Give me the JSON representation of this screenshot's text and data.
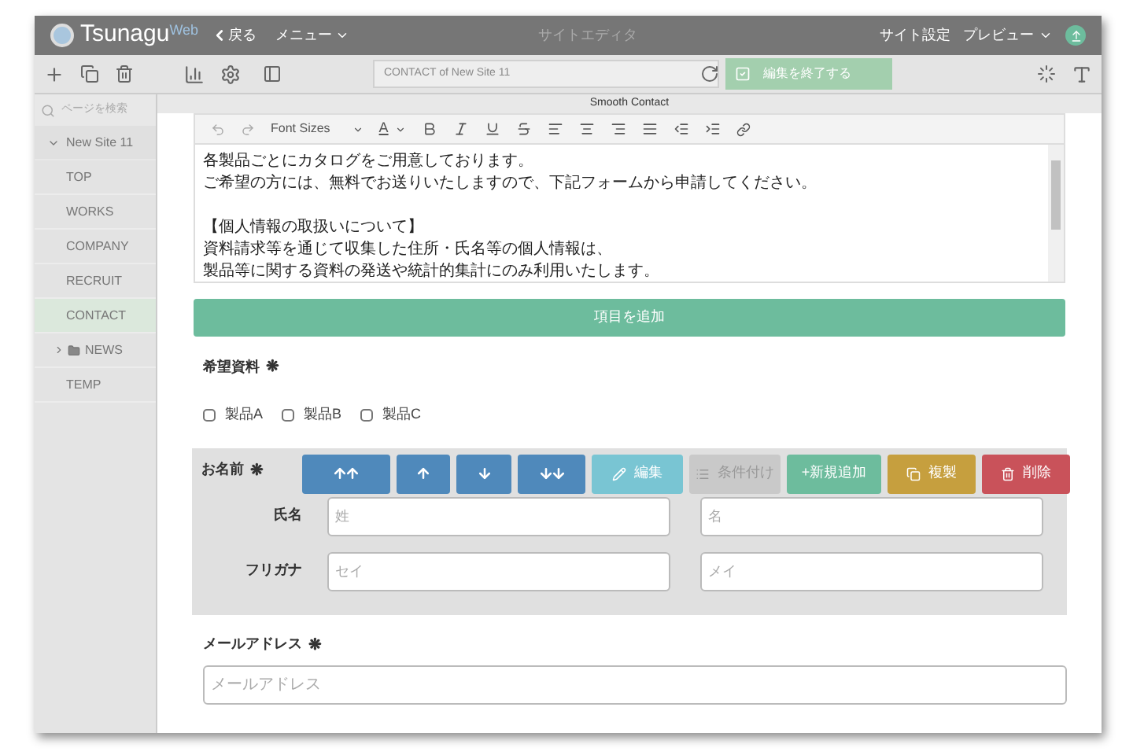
{
  "header": {
    "logo": "Tsunagu",
    "logo_suffix": "Web",
    "back": "戻る",
    "menu": "メニュー",
    "title": "サイトエディタ",
    "site_settings": "サイト設定",
    "preview": "プレビュー"
  },
  "toolbar": {
    "page_path": "CONTACT of New Site 11",
    "finish": "編集を終了する"
  },
  "sidebar": {
    "search": {
      "placeholder": "ページを検索"
    },
    "tree": [
      {
        "label": "New Site 11",
        "expanded": true,
        "children": [
          {
            "label": "TOP",
            "selected": false
          },
          {
            "label": "WORKS",
            "selected": false
          },
          {
            "label": "COMPANY",
            "selected": false
          },
          {
            "label": "RECRUIT",
            "selected": false
          },
          {
            "label": "CONTACT",
            "selected": true
          },
          {
            "label": "NEWS",
            "selected": false,
            "kind": "folder",
            "expanded": false
          },
          {
            "label": "TEMP",
            "selected": false
          }
        ]
      }
    ]
  },
  "panel": {
    "title": "Smooth Contact",
    "editor": {
      "font_sizes": "Font Sizes",
      "text_color": "A",
      "paragraphs": [
        {
          "lines": [
            "各製品ごとにカタログをご用意しております。",
            "ご希望の方には、無料でお送りいたしますので、下記フォームから申請してください。"
          ]
        },
        {
          "lines": [
            "【個人情報の取扱いについて】",
            "資料請求等を通じて収集した住所・氏名等の個人情報は、",
            "製品等に関する資料の発送や統計的集計にのみ利用いたします。"
          ]
        }
      ]
    },
    "add_item": "項目を追加",
    "fields": [
      {
        "kind": "checkboxes",
        "label": "希望資料",
        "required_mark": "❋",
        "options": [
          {
            "label": "製品A",
            "checked": false
          },
          {
            "label": "製品B",
            "checked": false
          },
          {
            "label": "製品C",
            "checked": false
          }
        ]
      },
      {
        "kind": "name",
        "label": "お名前",
        "required_mark": "❋",
        "actions": [
          {
            "kind": "top"
          },
          {
            "kind": "up"
          },
          {
            "kind": "down"
          },
          {
            "kind": "bottom"
          },
          {
            "kind": "edit",
            "label": "編集",
            "disabled": false
          },
          {
            "kind": "condition",
            "label": "条件付け",
            "disabled": true
          },
          {
            "kind": "add",
            "label": "+新規追加",
            "disabled": false
          },
          {
            "kind": "copy",
            "label": "複製",
            "disabled": false
          },
          {
            "kind": "delete",
            "label": "削除",
            "disabled": false
          }
        ],
        "rows": [
          {
            "label": "氏名",
            "inputs": [
              {
                "placeholder": "姓"
              },
              {
                "placeholder": "名"
              }
            ]
          },
          {
            "label": "フリガナ",
            "inputs": [
              {
                "placeholder": "セイ"
              },
              {
                "placeholder": "メイ"
              }
            ]
          }
        ]
      },
      {
        "kind": "text",
        "label": "メールアドレス",
        "required_mark": "❋",
        "placeholder": "メールアドレス"
      }
    ]
  }
}
